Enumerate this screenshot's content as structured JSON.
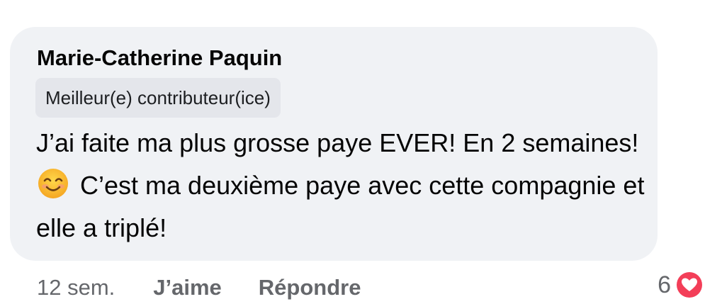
{
  "comment": {
    "author": "Marie-Catherine Paquin",
    "badge": "Meilleur(e) contributeur(ice)",
    "text_part1": "J’ai faite ma plus grosse paye EVER! En 2 semaines!",
    "emoji_icon": "smiling-face-emoji",
    "text_part2": "C’est ma deuxième paye avec cette compagnie et elle a triplé!"
  },
  "actions": {
    "timestamp": "12 sem.",
    "like_label": "J’aime",
    "reply_label": "Répondre"
  },
  "reactions": {
    "count": "6",
    "icon": "heart-reaction-icon",
    "color": "#f33e58"
  },
  "colors": {
    "bubble": "#f0f2f5",
    "badge": "#e4e6eb",
    "secondary_text": "#65676b"
  }
}
